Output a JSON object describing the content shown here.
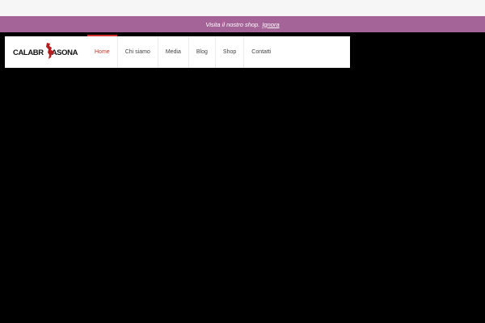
{
  "notice": {
    "text": "Visita il nostro shop.",
    "dismiss_label": "Ignora"
  },
  "brand": {
    "logo_text_left": "CALABR",
    "logo_text_right": "ASONA",
    "icon": "calabria-map-icon"
  },
  "nav": {
    "items": [
      {
        "label": "Home",
        "active": true
      },
      {
        "label": "Chi siamo"
      },
      {
        "label": "Media"
      },
      {
        "label": "Blog"
      },
      {
        "label": "Shop"
      },
      {
        "label": "Contatti"
      }
    ]
  },
  "colors": {
    "notice_bg": "#a46497",
    "accent": "#d32f2f",
    "page_bg": "#000000"
  }
}
